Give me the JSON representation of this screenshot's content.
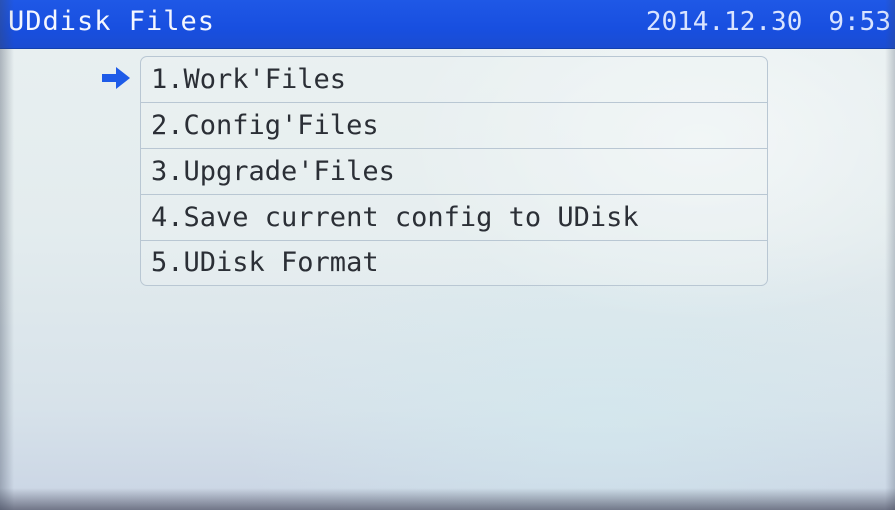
{
  "header": {
    "title": "UDdisk Files",
    "date": "2014.12.30",
    "time": "9:53"
  },
  "menu": {
    "selected_index": 0,
    "items": [
      {
        "label": "1.Work'Files"
      },
      {
        "label": "2.Config'Files"
      },
      {
        "label": "3.Upgrade'Files"
      },
      {
        "label": "4.Save current config to UDisk"
      },
      {
        "label": "5.UDisk Format"
      }
    ]
  },
  "icons": {
    "pointer": "arrow-right-icon"
  },
  "colors": {
    "title_bar": "#1f58e6",
    "pointer": "#1e5be8",
    "text": "#2b2f36"
  }
}
